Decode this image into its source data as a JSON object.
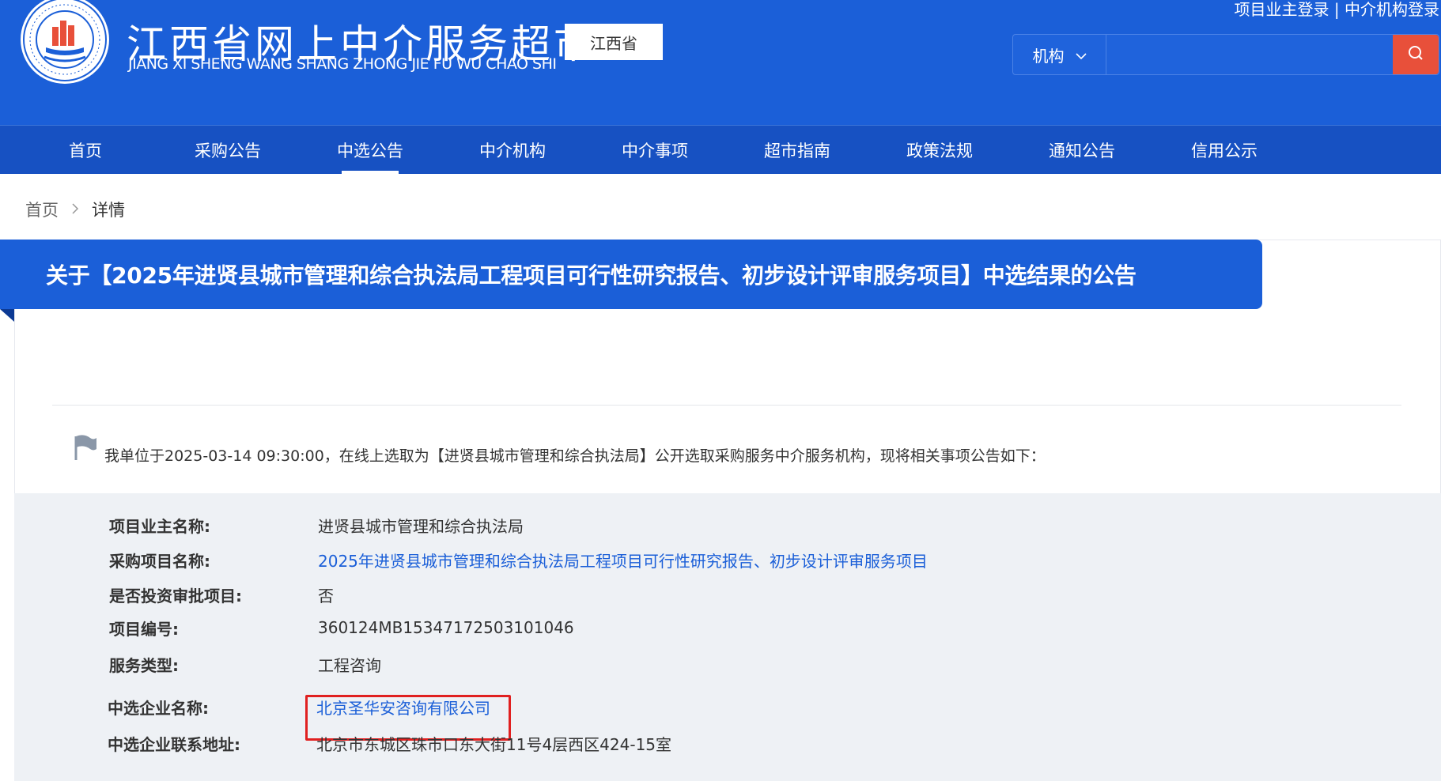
{
  "site": {
    "title": "江西省网上中介服务超市",
    "subtitle": "JIANG XI SHENG WANG SHANG ZHONG JIE FU WU CHAO SHI",
    "region": "江西省",
    "login_owner": "项目业主登录",
    "login_sep": " | ",
    "login_agency": "中介机构登录",
    "search_type": "机构",
    "search_placeholder": "",
    "colors": {
      "header": "#1b5fd8",
      "nav": "#1751c2",
      "search_button": "#e8503a",
      "highlight_border": "#e02020"
    }
  },
  "nav": {
    "items": [
      {
        "label": "首页"
      },
      {
        "label": "采购公告"
      },
      {
        "label": "中选公告"
      },
      {
        "label": "中介机构"
      },
      {
        "label": "中介事项"
      },
      {
        "label": "超市指南"
      },
      {
        "label": "政策法规"
      },
      {
        "label": "通知公告"
      },
      {
        "label": "信用公示"
      }
    ],
    "active": "中选公告"
  },
  "breadcrumb": {
    "home": "首页",
    "separator": ">",
    "current": "详情"
  },
  "article": {
    "title": "关于【2025年进贤县城市管理和综合执法局工程项目可行性研究报告、初步设计评审服务项目】中选结果的公告",
    "intro": "我单位于2025-03-14 09:30:00，在线上选取为【进贤县城市管理和综合执法局】公开选取采购服务中介服务机构，现将相关事项公告如下："
  },
  "details": [
    {
      "label": "项目业主名称:",
      "value": "进贤县城市管理和综合执法局",
      "link": false
    },
    {
      "label": "采购项目名称:",
      "value": "2025年进贤县城市管理和综合执法局工程项目可行性研究报告、初步设计评审服务项目",
      "link": true
    },
    {
      "label": "是否投资审批项目:",
      "value": "否",
      "link": false
    },
    {
      "label": "项目编号:",
      "value": "360124MB15347172503101046",
      "link": false
    },
    {
      "label": "服务类型:",
      "value": "工程咨询",
      "link": false
    },
    {
      "label": "中选企业名称:",
      "value": "北京圣华安咨询有限公司",
      "link": true
    },
    {
      "label": "中选企业联系地址:",
      "value": "北京市东城区珠市口东大街11号4层西区424-15室",
      "link": false
    }
  ]
}
